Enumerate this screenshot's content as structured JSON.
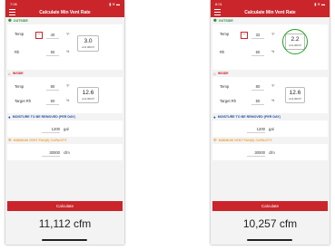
{
  "colors": {
    "nav_bar": "#c9252b",
    "button": "#c9252b",
    "outside_header": "#2e8b3a",
    "inside_header": "#c9252b",
    "moisture_header": "#1e4fa0",
    "fan_header": "#f0a33a",
    "highlight": "#1ea41e"
  },
  "screens": [
    {
      "status_time": "7:06",
      "status_icons": "▮ ≋ ▬",
      "title": "Calculate Min Vent Rate",
      "outside": {
        "header": "OUTSIDE",
        "temp_label": "Temp",
        "minus_label": "−",
        "temp_value": "40",
        "temp_unit": "°F",
        "rh_label": "Rh",
        "rh_value": "50",
        "rh_unit": "%",
        "result_value": "3.0",
        "result_unit": "oz/1,000 ft³"
      },
      "inside": {
        "header": "INSIDE",
        "temp_label": "Temp",
        "temp_value": "80",
        "temp_unit": "°F",
        "rh_label": "Target Rh",
        "rh_value": "50",
        "rh_unit": "%",
        "result_value": "12.6",
        "result_unit": "oz/1,000 ft³"
      },
      "moisture": {
        "header": "MOISTURE TO BE REMOVED (PER DAY)",
        "value": "1200",
        "unit": "gal"
      },
      "fan": {
        "header": "MINIMUM VENT FAN(S) CAPACITY",
        "value": "30000",
        "unit": "cfm"
      },
      "calculate_label": "Calculate",
      "result": "11,112 cfm"
    },
    {
      "status_time": "8:01",
      "status_icons": "▮ ≋ ▬",
      "title": "Calculate Min Vent Rate",
      "outside": {
        "header": "OUTSIDE",
        "temp_label": "Temp",
        "minus_label": "−",
        "temp_value": "32",
        "temp_unit": "°F",
        "rh_label": "Rh",
        "rh_value": "50",
        "rh_unit": "%",
        "result_value": "2.2",
        "result_unit": "oz/1,000 ft³"
      },
      "inside": {
        "header": "INSIDE",
        "temp_label": "Temp",
        "temp_value": "80",
        "temp_unit": "°F",
        "rh_label": "Target Rh",
        "rh_value": "50",
        "rh_unit": "%",
        "result_value": "12.6",
        "result_unit": "oz/1,000 ft³"
      },
      "moisture": {
        "header": "MOISTURE TO BE REMOVED (PER DAY)",
        "value": "1200",
        "unit": "gal"
      },
      "fan": {
        "header": "MINIMUM VENT FAN(S) CAPACITY",
        "value": "30000",
        "unit": "cfm"
      },
      "calculate_label": "Calculate",
      "result": "10,257 cfm"
    }
  ]
}
